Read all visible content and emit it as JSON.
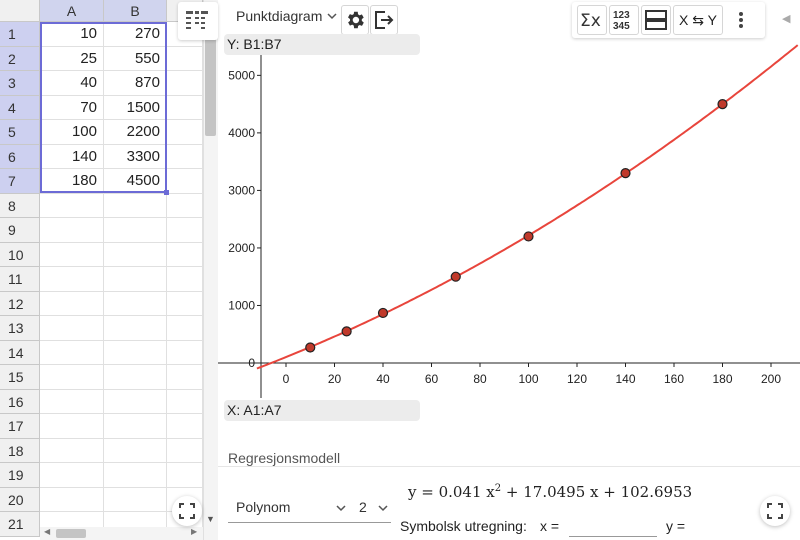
{
  "spreadsheet": {
    "columns": [
      "A",
      "B"
    ],
    "row_numbers": [
      "1",
      "2",
      "3",
      "4",
      "5",
      "6",
      "7",
      "8",
      "9",
      "10",
      "11",
      "12",
      "13",
      "14",
      "15",
      "16",
      "17",
      "18",
      "19",
      "20",
      "21"
    ],
    "rows": [
      [
        "10",
        "270"
      ],
      [
        "25",
        "550"
      ],
      [
        "40",
        "870"
      ],
      [
        "70",
        "1500"
      ],
      [
        "100",
        "2200"
      ],
      [
        "140",
        "3300"
      ],
      [
        "180",
        "4500"
      ]
    ]
  },
  "toolbar": {
    "plot_type": "Punktdiagram",
    "swap_label": "X ⇆ Y",
    "stats_icon": "sigma-x-icon",
    "number_icon_top": "123",
    "number_icon_bottom": "345"
  },
  "fields": {
    "y_label": "Y:",
    "y_range": "B1:B7",
    "x_label": "X:",
    "x_range": "A1:A7"
  },
  "chart_data": {
    "type": "scatter",
    "x": [
      10,
      25,
      40,
      70,
      100,
      140,
      180
    ],
    "y": [
      270,
      550,
      870,
      1500,
      2200,
      3300,
      4500
    ],
    "xlim": [
      -12,
      212
    ],
    "ylim": [
      -220,
      5600
    ],
    "x_ticks": [
      0,
      20,
      40,
      60,
      80,
      100,
      120,
      140,
      160,
      180,
      200
    ],
    "y_ticks": [
      0,
      1000,
      2000,
      3000,
      4000,
      5000
    ],
    "grid": false,
    "point_color": "#c0392b",
    "curve_color": "#e8453c",
    "regression": {
      "a": 0.041,
      "b": 17.0495,
      "c": 102.6953
    }
  },
  "regression": {
    "title": "Regresjonsmodell",
    "model": "Polynom",
    "degree": "2",
    "formula_prefix": "y = 0.041 x",
    "formula_exp": "2",
    "formula_suffix": " + 17.0495 x + 102.6953",
    "symbolic_label": "Symbolsk utregning:",
    "x_label": "x =",
    "x_value": "",
    "y_label": "y ="
  }
}
